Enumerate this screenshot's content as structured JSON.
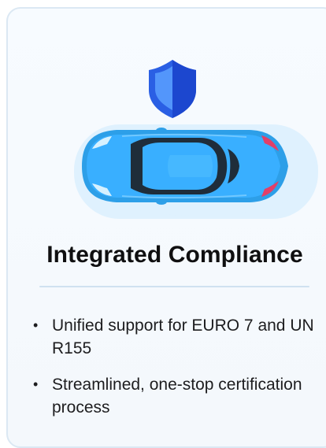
{
  "card": {
    "title": "Integrated Compliance",
    "bullets": [
      "Unified support for EURO 7 and UN R155",
      "Streamlined, one-stop certification process"
    ],
    "icons": {
      "shield": "shield-icon",
      "car": "car-top-view-icon"
    }
  },
  "colors": {
    "card_border": "#dbe8f3",
    "card_background": "#f7fbff",
    "car_body": "#33a8f2",
    "shield": "#2f62e6",
    "divider": "#cfe1f0",
    "title_text": "#0f0f10"
  }
}
